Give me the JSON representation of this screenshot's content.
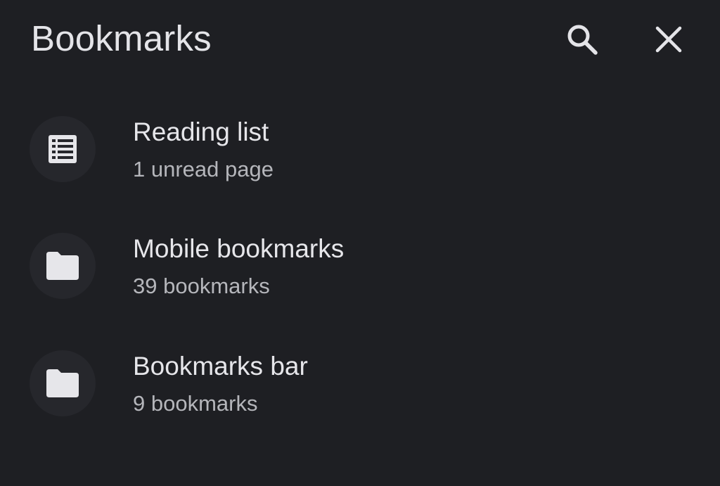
{
  "header": {
    "title": "Bookmarks",
    "search_icon": "search-icon",
    "close_icon": "close-icon"
  },
  "items": [
    {
      "title": "Reading list",
      "subtitle": "1 unread page",
      "icon": "reading-list-icon"
    },
    {
      "title": "Mobile bookmarks",
      "subtitle": "39 bookmarks",
      "icon": "folder-icon"
    },
    {
      "title": "Bookmarks bar",
      "subtitle": "9 bookmarks",
      "icon": "folder-icon"
    }
  ],
  "colors": {
    "background": "#1e1f23",
    "text_primary": "#e6e6ea",
    "text_secondary": "#b5b6bb",
    "icon_circle": "#26272c"
  }
}
